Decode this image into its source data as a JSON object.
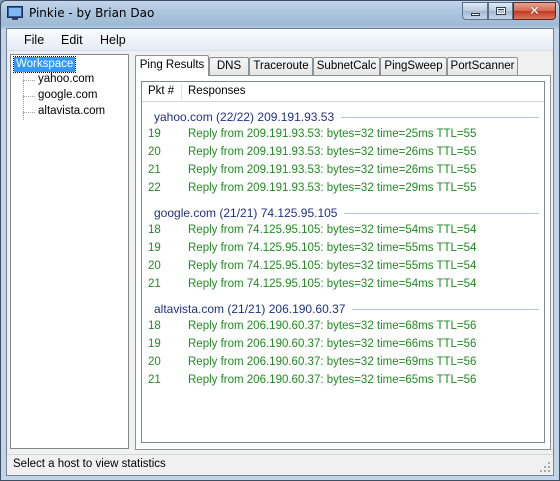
{
  "window": {
    "title": "Pinkie - by Brian Dao"
  },
  "menu": {
    "file": "File",
    "edit": "Edit",
    "help": "Help"
  },
  "tree": {
    "root": "Workspace",
    "hosts": [
      "yahoo.com",
      "google.com",
      "altavista.com"
    ]
  },
  "tabs": [
    "Ping Results",
    "DNS",
    "Traceroute",
    "SubnetCalc",
    "PingSweep",
    "PortScanner"
  ],
  "active_tab": "Ping Results",
  "results": {
    "columns": {
      "pkt": "Pkt #",
      "responses": "Responses"
    },
    "groups": [
      {
        "title": "yahoo.com (22/22) 209.191.93.53",
        "rows": [
          {
            "pkt": "19",
            "resp": "Reply from 209.191.93.53: bytes=32 time=25ms TTL=55"
          },
          {
            "pkt": "20",
            "resp": "Reply from 209.191.93.53: bytes=32 time=26ms TTL=55"
          },
          {
            "pkt": "21",
            "resp": "Reply from 209.191.93.53: bytes=32 time=26ms TTL=55"
          },
          {
            "pkt": "22",
            "resp": "Reply from 209.191.93.53: bytes=32 time=29ms TTL=55"
          }
        ]
      },
      {
        "title": "google.com (21/21) 74.125.95.105",
        "rows": [
          {
            "pkt": "18",
            "resp": "Reply from 74.125.95.105: bytes=32 time=54ms TTL=54"
          },
          {
            "pkt": "19",
            "resp": "Reply from 74.125.95.105: bytes=32 time=55ms TTL=54"
          },
          {
            "pkt": "20",
            "resp": "Reply from 74.125.95.105: bytes=32 time=55ms TTL=54"
          },
          {
            "pkt": "21",
            "resp": "Reply from 74.125.95.105: bytes=32 time=54ms TTL=54"
          }
        ]
      },
      {
        "title": "altavista.com (21/21) 206.190.60.37",
        "rows": [
          {
            "pkt": "18",
            "resp": "Reply from 206.190.60.37: bytes=32 time=68ms TTL=56"
          },
          {
            "pkt": "19",
            "resp": "Reply from 206.190.60.37: bytes=32 time=66ms TTL=56"
          },
          {
            "pkt": "20",
            "resp": "Reply from 206.190.60.37: bytes=32 time=69ms TTL=56"
          },
          {
            "pkt": "21",
            "resp": "Reply from 206.190.60.37: bytes=32 time=65ms TTL=56"
          }
        ]
      }
    ]
  },
  "status": {
    "text": "Select a host to view statistics"
  },
  "colors": {
    "selection": "#3399ff",
    "group_title": "#1e3287",
    "reply_text": "#1f8c1f",
    "close_button": "#c4361e"
  },
  "icons": {
    "app": "monitor-icon",
    "minimize": "minimize-icon",
    "maximize": "maximize-icon",
    "close": "close-icon",
    "grip": "resize-grip-icon"
  }
}
